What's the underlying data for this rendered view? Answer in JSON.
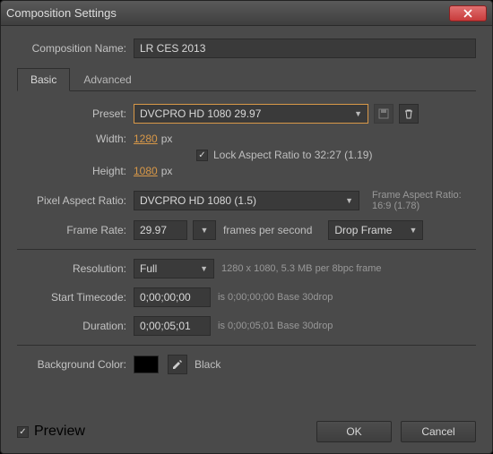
{
  "window": {
    "title": "Composition Settings"
  },
  "nameRow": {
    "label": "Composition Name:",
    "value": "LR CES 2013"
  },
  "tabs": {
    "basic": "Basic",
    "advanced": "Advanced"
  },
  "preset": {
    "label": "Preset:",
    "value": "DVCPRO HD 1080 29.97"
  },
  "width": {
    "label": "Width:",
    "value": "1280",
    "unit": "px"
  },
  "height": {
    "label": "Height:",
    "value": "1080",
    "unit": "px"
  },
  "lockAspect": {
    "label": "Lock Aspect Ratio to 32:27 (1.19)"
  },
  "par": {
    "label": "Pixel Aspect Ratio:",
    "value": "DVCPRO HD 1080 (1.5)",
    "frameAspect1": "Frame Aspect Ratio:",
    "frameAspect2": "16:9 (1.78)"
  },
  "frameRate": {
    "label": "Frame Rate:",
    "value": "29.97",
    "suffix": "frames per second",
    "dropMode": "Drop Frame"
  },
  "resolution": {
    "label": "Resolution:",
    "value": "Full",
    "info": "1280 x 1080, 5.3 MB per 8bpc frame"
  },
  "startTC": {
    "label": "Start Timecode:",
    "value": "0;00;00;00",
    "info": "is 0;00;00;00  Base 30drop"
  },
  "duration": {
    "label": "Duration:",
    "value": "0;00;05;01",
    "info": "is 0;00;05;01  Base 30drop"
  },
  "bg": {
    "label": "Background Color:",
    "name": "Black",
    "hex": "#000000"
  },
  "preview": {
    "label": "Preview"
  },
  "buttons": {
    "ok": "OK",
    "cancel": "Cancel"
  },
  "icons": {
    "save": "save-preset-icon",
    "trash": "trash-icon",
    "eyedrop": "eyedropper-icon",
    "close": "close-icon"
  }
}
